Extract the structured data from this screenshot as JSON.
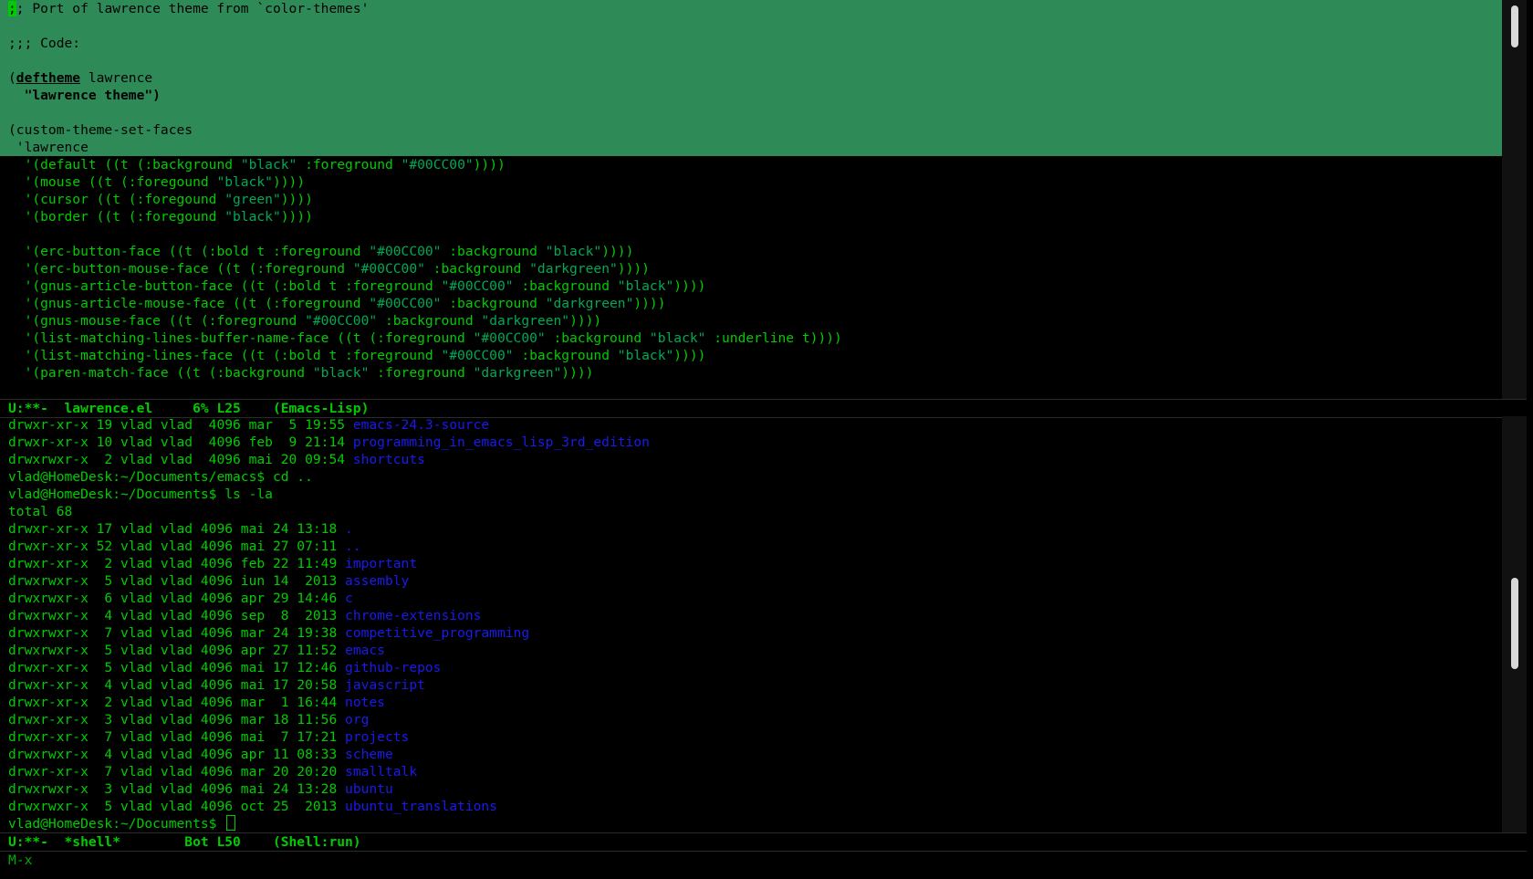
{
  "code_buffer": {
    "region_lines": [
      {
        "prefix": ";",
        "text": "; Port of lawrence theme from `color-themes'"
      },
      {
        "text": ""
      },
      {
        "text": ";;; Code:"
      },
      {
        "text": ""
      },
      {
        "open": "(",
        "kw": "deftheme",
        "rest": " lawrence"
      },
      {
        "docstr": "  \"lawrence theme\")"
      },
      {
        "text": ""
      },
      {
        "text": "(custom-theme-set-faces"
      },
      {
        "text": " 'lawrence"
      }
    ],
    "face_lines": [
      [
        {
          "t": "  '(default ((t (:background "
        },
        {
          "s": "\"black\""
        },
        {
          "t": " :foreground "
        },
        {
          "s": "\"#00CC00\""
        },
        {
          "t": "))))"
        }
      ],
      [
        {
          "t": "  '(mouse ((t (:foregound "
        },
        {
          "s": "\"black\""
        },
        {
          "t": "))))"
        }
      ],
      [
        {
          "t": "  '(cursor ((t (:foregound "
        },
        {
          "s": "\"green\""
        },
        {
          "t": "))))"
        }
      ],
      [
        {
          "t": "  '(border ((t (:foregound "
        },
        {
          "s": "\"black\""
        },
        {
          "t": "))))"
        }
      ],
      [
        {
          "t": ""
        }
      ],
      [
        {
          "t": "  '(erc-button-face ((t (:bold t :foreground "
        },
        {
          "s": "\"#00CC00\""
        },
        {
          "t": " :background "
        },
        {
          "s": "\"black\""
        },
        {
          "t": "))))"
        }
      ],
      [
        {
          "t": "  '(erc-button-mouse-face ((t (:foreground "
        },
        {
          "s": "\"#00CC00\""
        },
        {
          "t": " :background "
        },
        {
          "s": "\"darkgreen\""
        },
        {
          "t": "))))"
        }
      ],
      [
        {
          "t": "  '(gnus-article-button-face ((t (:bold t :foreground "
        },
        {
          "s": "\"#00CC00\""
        },
        {
          "t": " :background "
        },
        {
          "s": "\"black\""
        },
        {
          "t": "))))"
        }
      ],
      [
        {
          "t": "  '(gnus-article-mouse-face ((t (:foreground "
        },
        {
          "s": "\"#00CC00\""
        },
        {
          "t": " :background "
        },
        {
          "s": "\"darkgreen\""
        },
        {
          "t": "))))"
        }
      ],
      [
        {
          "t": "  '(gnus-mouse-face ((t (:foreground "
        },
        {
          "s": "\"#00CC00\""
        },
        {
          "t": " :background "
        },
        {
          "s": "\"darkgreen\""
        },
        {
          "t": "))))"
        }
      ],
      [
        {
          "t": "  '(list-matching-lines-buffer-name-face ((t (:foreground "
        },
        {
          "s": "\"#00CC00\""
        },
        {
          "t": " :background "
        },
        {
          "s": "\"black\""
        },
        {
          "t": " :underline t))))"
        }
      ],
      [
        {
          "t": "  '(list-matching-lines-face ((t (:bold t :foreground "
        },
        {
          "s": "\"#00CC00\""
        },
        {
          "t": " :background "
        },
        {
          "s": "\"black\""
        },
        {
          "t": "))))"
        }
      ],
      [
        {
          "t": "  '(paren-match-face ((t (:background "
        },
        {
          "s": "\"black\""
        },
        {
          "t": " :foreground "
        },
        {
          "s": "\"darkgreen\""
        },
        {
          "t": "))))"
        }
      ]
    ]
  },
  "modeline_code": "U:**-  lawrence.el     6% L25    (Emacs-Lisp)",
  "shell_buffer": {
    "lines": [
      {
        "meta": "drwxr-xr-x 19 vlad vlad  4096 mar  5 19:55 ",
        "name": "emacs-24.3-source"
      },
      {
        "meta": "drwxr-xr-x 10 vlad vlad  4096 feb  9 21:14 ",
        "name": "programming_in_emacs_lisp_3rd_edition"
      },
      {
        "meta": "drwxrwxr-x  2 vlad vlad  4096 mai 20 09:54 ",
        "name": "shortcuts"
      },
      {
        "meta": "vlad@HomeDesk:~/Documents/emacs$ cd .."
      },
      {
        "meta": "vlad@HomeDesk:~/Documents$ ls -la"
      },
      {
        "meta": "total 68"
      },
      {
        "meta": "drwxr-xr-x 17 vlad vlad 4096 mai 24 13:18 ",
        "name": "."
      },
      {
        "meta": "drwxr-xr-x 52 vlad vlad 4096 mai 27 07:11 ",
        "name": ".."
      },
      {
        "meta": "drwxr-xr-x  2 vlad vlad 4096 feb 22 11:49 ",
        "name": "important"
      },
      {
        "meta": "drwxrwxr-x  5 vlad vlad 4096 iun 14  2013 ",
        "name": "assembly"
      },
      {
        "meta": "drwxrwxr-x  6 vlad vlad 4096 apr 29 14:46 ",
        "name": "c"
      },
      {
        "meta": "drwxrwxr-x  4 vlad vlad 4096 sep  8  2013 ",
        "name": "chrome-extensions"
      },
      {
        "meta": "drwxrwxr-x  7 vlad vlad 4096 mar 24 19:38 ",
        "name": "competitive_programming"
      },
      {
        "meta": "drwxrwxr-x  5 vlad vlad 4096 apr 27 11:52 ",
        "name": "emacs"
      },
      {
        "meta": "drwxr-xr-x  5 vlad vlad 4096 mai 17 12:46 ",
        "name": "github-repos"
      },
      {
        "meta": "drwxr-xr-x  4 vlad vlad 4096 mai 17 20:58 ",
        "name": "javascript"
      },
      {
        "meta": "drwxr-xr-x  2 vlad vlad 4096 mar  1 16:44 ",
        "name": "notes"
      },
      {
        "meta": "drwxr-xr-x  3 vlad vlad 4096 mar 18 11:56 ",
        "name": "org"
      },
      {
        "meta": "drwxr-xr-x  7 vlad vlad 4096 mai  7 17:21 ",
        "name": "projects"
      },
      {
        "meta": "drwxrwxr-x  4 vlad vlad 4096 apr 11 08:33 ",
        "name": "scheme"
      },
      {
        "meta": "drwxr-xr-x  7 vlad vlad 4096 mar 20 20:20 ",
        "name": "smalltalk"
      },
      {
        "meta": "drwxrwxr-x  3 vlad vlad 4096 mai 24 13:28 ",
        "name": "ubuntu"
      },
      {
        "meta": "drwxrwxr-x  5 vlad vlad 4096 oct 25  2013 ",
        "name": "ubuntu_translations"
      }
    ],
    "prompt": "vlad@HomeDesk:~/Documents$ "
  },
  "modeline_shell": "U:**-  *shell*        Bot L50    (Shell:run)",
  "minibuffer": "M-x",
  "colors": {
    "background": "#000000",
    "foreground": "#00cc00",
    "region": "#2e8b57",
    "string": "#00aa55",
    "directory": "#1a1aee"
  }
}
